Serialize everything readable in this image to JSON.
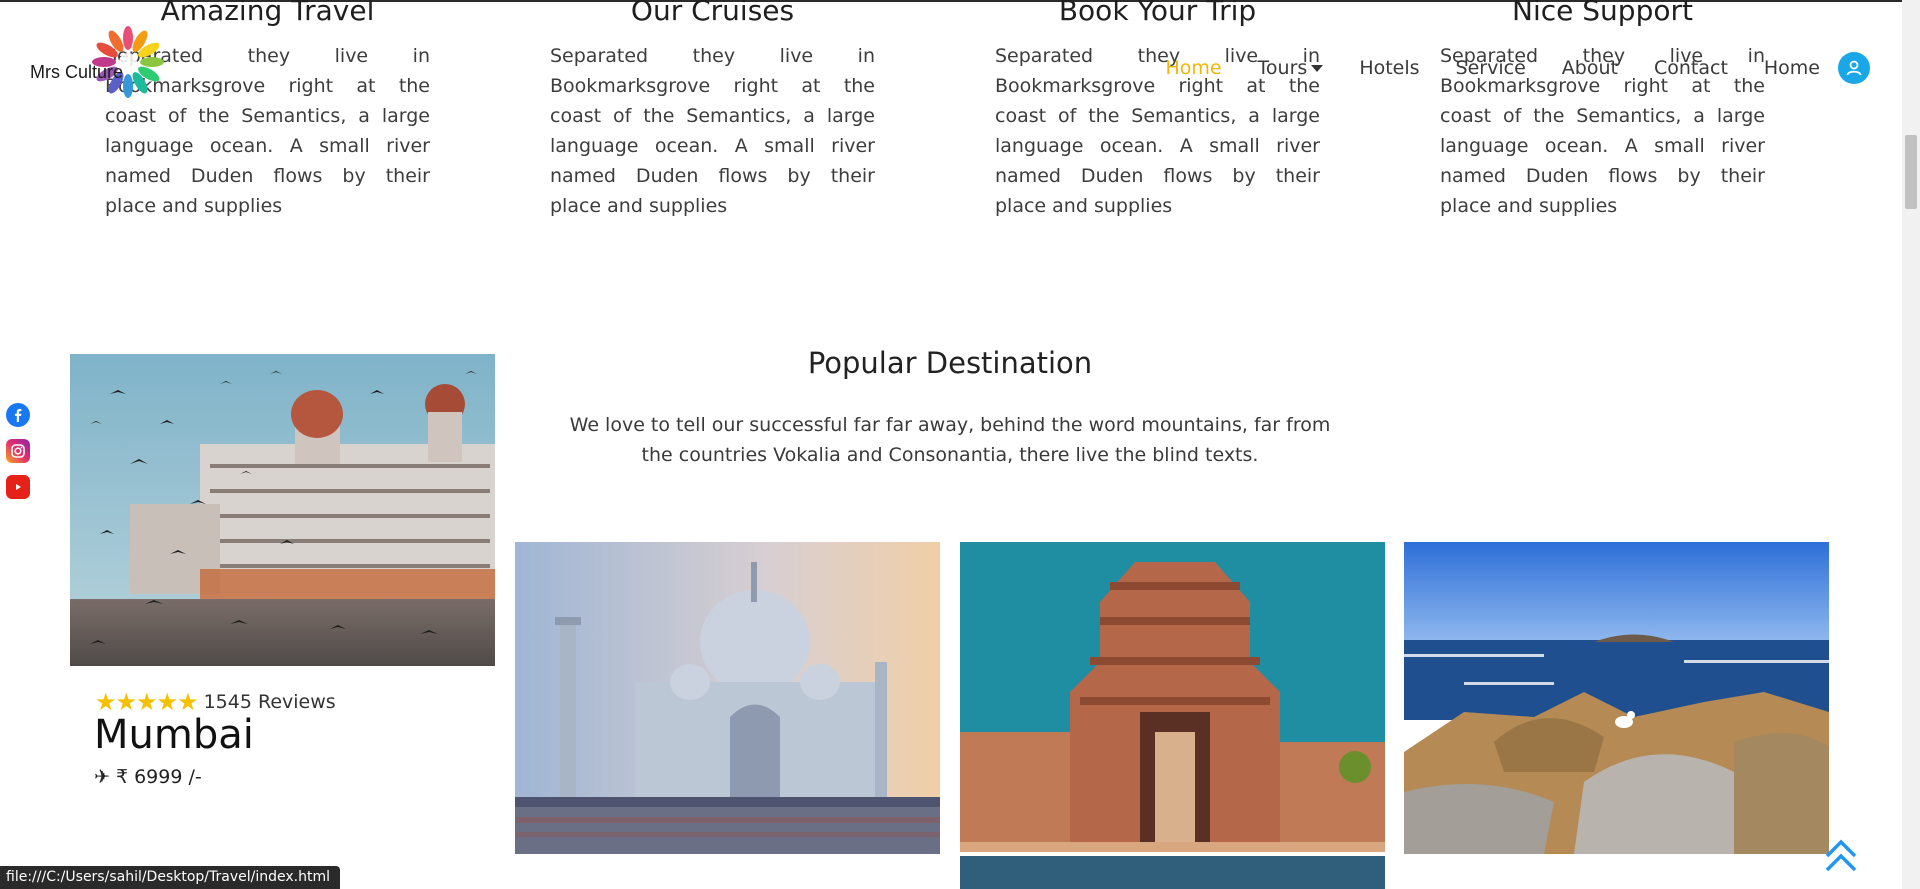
{
  "brand": {
    "name": "Mrs Culture"
  },
  "nav": {
    "items": [
      {
        "label": "Home",
        "active": true
      },
      {
        "label": "Tours",
        "dropdown": true
      },
      {
        "label": "Hotels"
      },
      {
        "label": "Service"
      },
      {
        "label": "About"
      },
      {
        "label": "Contact"
      },
      {
        "label": "Home"
      }
    ]
  },
  "services": [
    {
      "title": "Amazing Travel",
      "text": "Separated they live in Bookmarksgrove right at the coast of the Semantics, a large language ocean. A small river named Duden flows by their place and supplies"
    },
    {
      "title": "Our Cruises",
      "text": "Separated they live in Bookmarksgrove right at the coast of the Semantics, a large language ocean. A small river named Duden flows by their place and supplies"
    },
    {
      "title": "Book Your Trip",
      "text": "Separated they live in Bookmarksgrove right at the coast of the Semantics, a large language ocean. A small river named Duden flows by their place and supplies"
    },
    {
      "title": "Nice Support",
      "text": "Separated they live in Bookmarksgrove right at the coast of the Semantics, a large language ocean. A small river named Duden flows by their place and supplies"
    }
  ],
  "popular": {
    "title": "Popular Destination",
    "subtitle": "We love to tell our successful far far away, behind the word mountains, far from the countries Vokalia and Consonantia, there live the blind texts."
  },
  "featured": {
    "rating": 5,
    "reviews": "1545 Reviews",
    "city": "Mumbai",
    "price": "₹ 6999 /-"
  },
  "social": [
    "facebook-icon",
    "instagram-icon",
    "youtube-icon"
  ],
  "status_bar": "file:///C:/Users/sahil/Desktop/Travel/index.html",
  "colors": {
    "accent": "#f2b705",
    "link": "#19a7e8",
    "text": "#3d3d3d"
  }
}
